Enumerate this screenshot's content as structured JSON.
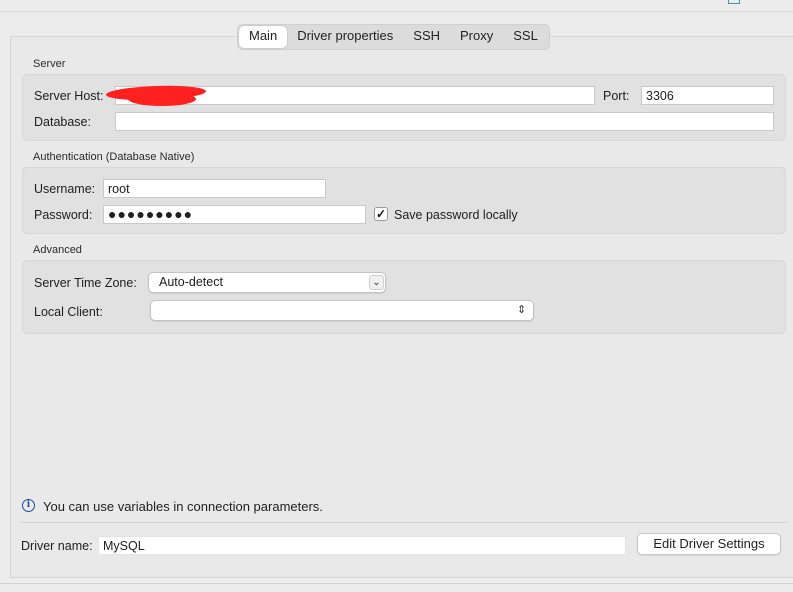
{
  "tabs": [
    "Main",
    "Driver properties",
    "SSH",
    "Proxy",
    "SSL"
  ],
  "active_tab": "Main",
  "server": {
    "section_title": "Server",
    "host_label": "Server Host:",
    "host_value": "",
    "port_label": "Port:",
    "port_value": "3306",
    "database_label": "Database:",
    "database_value": ""
  },
  "auth": {
    "section_title": "Authentication (Database Native)",
    "username_label": "Username:",
    "username_value": "root",
    "password_label": "Password:",
    "password_value": "●●●●●●●●●",
    "save_password_label": "Save password locally",
    "save_password_checked": true
  },
  "advanced": {
    "section_title": "Advanced",
    "timezone_label": "Server Time Zone:",
    "timezone_value": "Auto-detect",
    "local_client_label": "Local Client:",
    "local_client_value": ""
  },
  "info_text": "You can use variables in connection parameters.",
  "driver": {
    "label": "Driver name:",
    "value": "MySQL",
    "edit_button": "Edit Driver Settings"
  },
  "colors": {
    "redaction": "#ff2020",
    "info_icon": "#1a4fa0"
  },
  "icons": {
    "info": "info-circle-icon",
    "check": "checkmark-icon",
    "dropdown": "chevron-down-icon",
    "updown": "chevron-up-down-icon"
  }
}
